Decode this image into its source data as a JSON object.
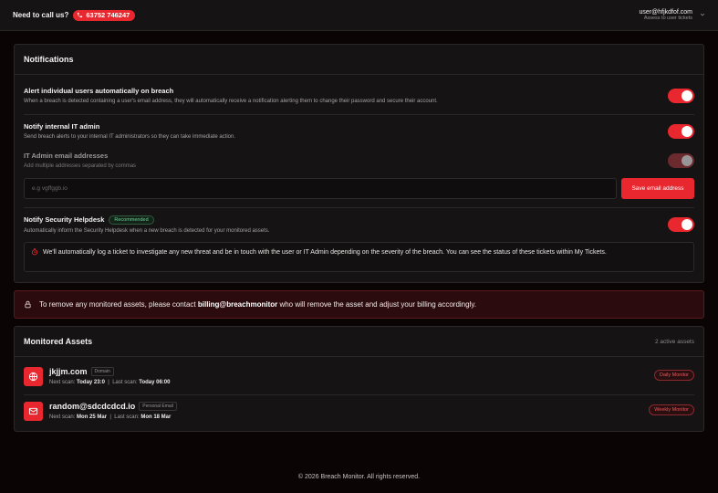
{
  "header": {
    "call_label": "Need to call us?",
    "phone": "63752 746247",
    "user_email": "user@hfjkdfof.com",
    "user_sub": "Assess to user tickets"
  },
  "notifications": {
    "title": "Notifications",
    "alert_users": {
      "title": "Alert individual users automatically on breach",
      "desc": "When a breach is detected containing a user's email address, they will automatically receive a notification alerting them to change their password and secure their account.",
      "enabled": true
    },
    "notify_it": {
      "title": "Notify internal IT admin",
      "desc": "Send breach alerts to your internal IT administrators so they can take immediate action.",
      "enabled": true
    },
    "it_emails": {
      "title": "IT Admin email addresses",
      "desc": "Add multiple addresses separated by commas",
      "placeholder": "e.g vgffggb.io",
      "value": "",
      "save_label": "Save email address",
      "enabled": true
    },
    "helpdesk": {
      "title": "Notify Security Helpdesk",
      "badge": "Recommended",
      "desc": "Automatically inform the Security Helpdesk when a new breach is detected for your monitored assets.",
      "enabled": true,
      "info": "We'll automatically log a ticket to investigate any new threat and be in touch with the user or IT Admin depending on the severity of the breach. You can see the status of these tickets within My Tickets."
    }
  },
  "alert": {
    "text_before": "To remove any monitored assets, please contact ",
    "email": "billing@breachmonitor",
    "text_after": " who will remove the asset and adjust your billing accordingly."
  },
  "assets": {
    "title": "Monitored Assets",
    "count": "2 active assets",
    "items": [
      {
        "name": "jkjjm.com",
        "type": "Domain",
        "icon": "globe-icon",
        "next_label": "Next scan:",
        "next": "Today 23:0",
        "sep": "|",
        "last_label": "Last scan:",
        "last": "Today 06:00",
        "monitor": "Daily Monitor"
      },
      {
        "name": "random@sdcdcdcd.io",
        "type": "Personal Email",
        "icon": "mail-icon",
        "next_label": "Next scan:",
        "next": "Mon 25 Mar",
        "sep": "|",
        "last_label": "Last scan:",
        "last": "Mon 18 Mar",
        "monitor": "Weekly Monitor"
      }
    ]
  },
  "footer": "© 2026 Breach Monitor. All rights reserved.",
  "colors": {
    "accent": "#e8272f",
    "background": "#0a0405",
    "card": "#151314",
    "alert_bg": "#2b0b0d"
  }
}
